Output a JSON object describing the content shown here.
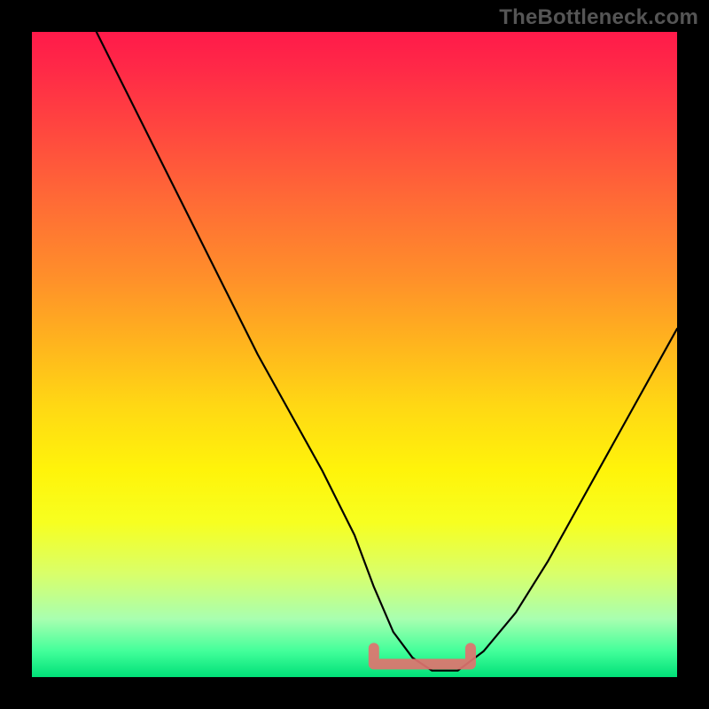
{
  "watermark": "TheBottleneck.com",
  "colors": {
    "frame": "#000000",
    "curve": "#000000",
    "bottom_marker": "#e0736f",
    "gradient_stops": [
      "#ff1a4a",
      "#ff2a47",
      "#ff4340",
      "#ff6a36",
      "#ff8f2a",
      "#ffb31e",
      "#ffd814",
      "#fff40a",
      "#f7ff20",
      "#d9ff6a",
      "#a8ffb0",
      "#42ff9a",
      "#00e078"
    ]
  },
  "chart_data": {
    "type": "line",
    "title": "",
    "xlabel": "",
    "ylabel": "",
    "xlim": [
      0,
      100
    ],
    "ylim": [
      0,
      100
    ],
    "series": [
      {
        "name": "bottleneck-curve",
        "x": [
          10,
          15,
          20,
          25,
          30,
          35,
          40,
          45,
          50,
          53,
          56,
          59,
          62,
          66,
          70,
          75,
          80,
          85,
          90,
          95,
          100
        ],
        "values": [
          100,
          90,
          80,
          70,
          60,
          50,
          41,
          32,
          22,
          14,
          7,
          3,
          1,
          1,
          4,
          10,
          18,
          27,
          36,
          45,
          54
        ]
      }
    ],
    "marker_region": {
      "x_start": 53,
      "x_end": 68,
      "y": 2
    }
  }
}
